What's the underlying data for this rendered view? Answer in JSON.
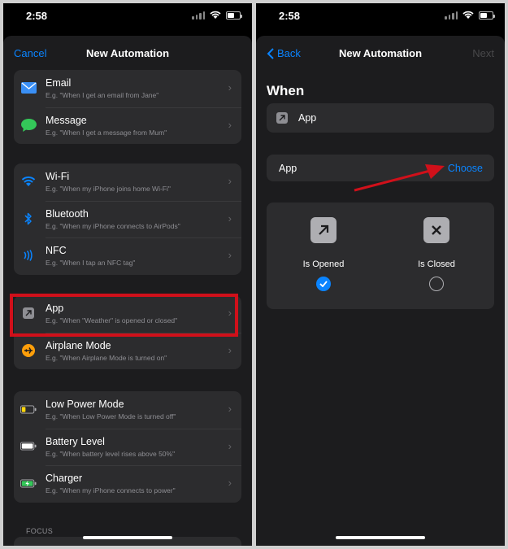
{
  "left": {
    "status": {
      "time": "2:58"
    },
    "nav": {
      "cancel_label": "Cancel",
      "title": "New Automation"
    },
    "groups": [
      {
        "items": [
          {
            "title": "Email",
            "subtitle": "E.g. \"When I get an email from Jane\"",
            "icon": "envelope-icon"
          },
          {
            "title": "Message",
            "subtitle": "E.g. \"When I get a message from Mum\"",
            "icon": "message-bubble-icon"
          }
        ]
      },
      {
        "items": [
          {
            "title": "Wi-Fi",
            "subtitle": "E.g. \"When my iPhone joins home Wi-Fi\"",
            "icon": "wifi-icon"
          },
          {
            "title": "Bluetooth",
            "subtitle": "E.g. \"When my iPhone connects to AirPods\"",
            "icon": "bluetooth-icon"
          },
          {
            "title": "NFC",
            "subtitle": "E.g. \"When I tap an NFC tag\"",
            "icon": "nfc-icon"
          }
        ]
      },
      {
        "items": [
          {
            "title": "App",
            "subtitle": "E.g. \"When \"Weather\" is opened or closed\"",
            "icon": "app-arrow-icon"
          },
          {
            "title": "Airplane Mode",
            "subtitle": "E.g. \"When Airplane Mode is turned on\"",
            "icon": "airplane-icon"
          }
        ]
      },
      {
        "items": [
          {
            "title": "Low Power Mode",
            "subtitle": "E.g. \"When Low Power Mode is turned off\"",
            "icon": "low-battery-icon"
          },
          {
            "title": "Battery Level",
            "subtitle": "E.g. \"When battery level rises above 50%\"",
            "icon": "battery-icon"
          },
          {
            "title": "Charger",
            "subtitle": "E.g. \"When my iPhone connects to power\"",
            "icon": "charging-battery-icon"
          }
        ]
      }
    ],
    "section_label": "FOCUS"
  },
  "right": {
    "status": {
      "time": "2:58"
    },
    "nav": {
      "back_label": "Back",
      "title": "New Automation",
      "next_label": "Next"
    },
    "heading": "When",
    "trigger_label": "App",
    "app_row": {
      "label": "App",
      "action": "Choose"
    },
    "options": [
      {
        "label": "Is Opened",
        "icon": "arrow-up-right-icon",
        "selected": true
      },
      {
        "label": "Is Closed",
        "icon": "x-mark-icon",
        "selected": false
      }
    ]
  },
  "colors": {
    "accent": "#0a84ff",
    "annotation_red": "#d0101a"
  }
}
